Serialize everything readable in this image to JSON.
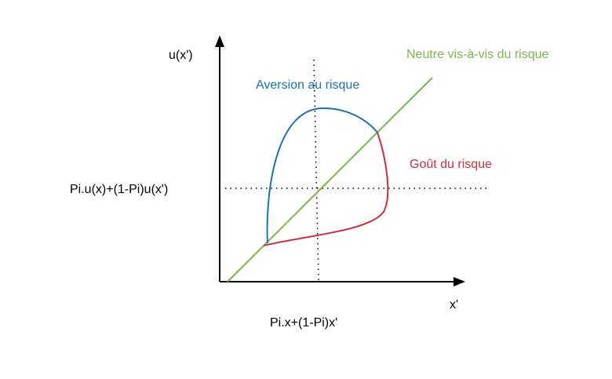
{
  "axes": {
    "y_label": "u(x')",
    "x_label": "x'",
    "y_value_label": "Pi.u(x)+(1-Pi)u(x')",
    "x_value_label": "Pi.x+(1-Pi)x'"
  },
  "curves": {
    "aversion": {
      "label": "Aversion au risque",
      "color": "#1a73b5"
    },
    "gout": {
      "label": "Goût du risque",
      "color": "#c8313c"
    },
    "neutre": {
      "label": "Neutre vis-à-vis du risque",
      "color": "#7ab648"
    }
  },
  "colors": {
    "axis": "#000000",
    "text": "#000000"
  }
}
